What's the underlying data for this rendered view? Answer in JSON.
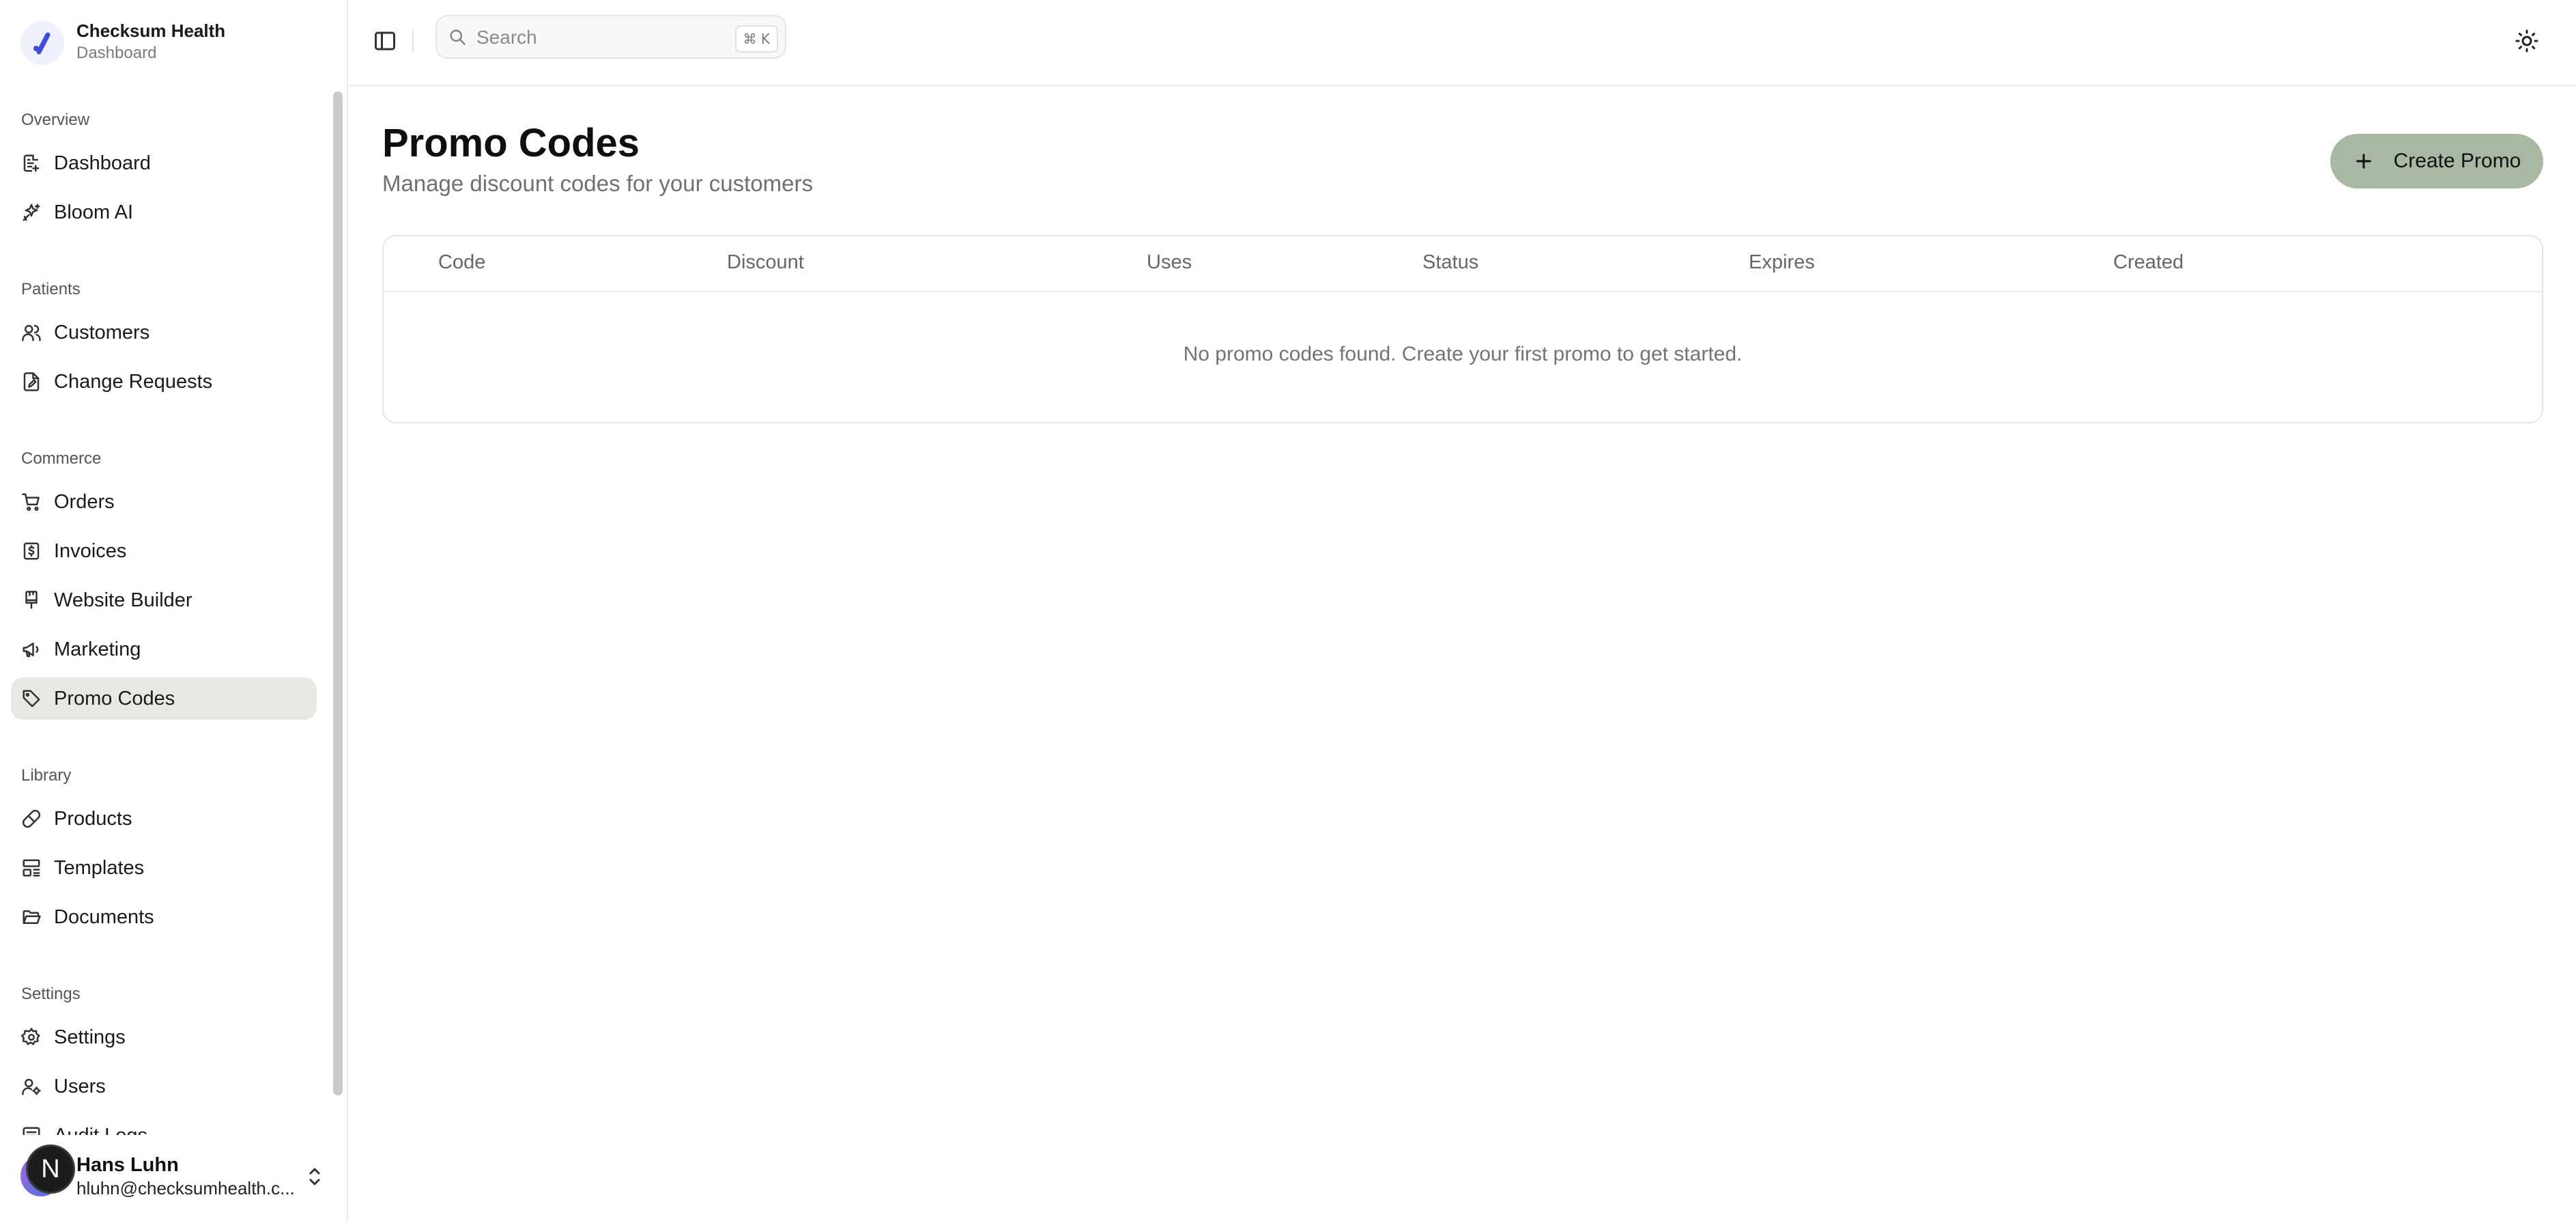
{
  "brand": {
    "name": "Checksum Health",
    "subtitle": "Dashboard"
  },
  "sidebar": {
    "sections": [
      {
        "title": "Overview",
        "items": [
          {
            "label": "Dashboard",
            "icon": "dashboard-icon"
          },
          {
            "label": "Bloom AI",
            "icon": "sparkles-icon"
          }
        ]
      },
      {
        "title": "Patients",
        "items": [
          {
            "label": "Customers",
            "icon": "users-icon"
          },
          {
            "label": "Change Requests",
            "icon": "file-edit-icon"
          }
        ]
      },
      {
        "title": "Commerce",
        "items": [
          {
            "label": "Orders",
            "icon": "cart-icon"
          },
          {
            "label": "Invoices",
            "icon": "invoice-icon"
          },
          {
            "label": "Website Builder",
            "icon": "brush-icon"
          },
          {
            "label": "Marketing",
            "icon": "megaphone-icon"
          },
          {
            "label": "Promo Codes",
            "icon": "tag-icon",
            "active": true
          }
        ]
      },
      {
        "title": "Library",
        "items": [
          {
            "label": "Products",
            "icon": "pill-icon"
          },
          {
            "label": "Templates",
            "icon": "layout-icon"
          },
          {
            "label": "Documents",
            "icon": "folder-icon"
          }
        ]
      },
      {
        "title": "Settings",
        "items": [
          {
            "label": "Settings",
            "icon": "gear-icon"
          },
          {
            "label": "Users",
            "icon": "user-key-icon"
          },
          {
            "label": "Audit Logs",
            "icon": "logs-icon"
          }
        ]
      }
    ]
  },
  "user": {
    "initial": "N",
    "name": "Hans Luhn",
    "email": "hluhn@checksumhealth.c..."
  },
  "topbar": {
    "search_placeholder": "Search",
    "shortcut": "⌘ K"
  },
  "page": {
    "title": "Promo Codes",
    "subtitle": "Manage discount codes for your customers",
    "create_label": "Create Promo"
  },
  "table": {
    "columns": [
      "Code",
      "Discount",
      "Uses",
      "Status",
      "Expires",
      "Created"
    ],
    "empty_message": "No promo codes found. Create your first promo to get started."
  },
  "colors": {
    "active_bg": "#e6e9e2",
    "primary_button": "#a9b8a2",
    "logo_accent": "#3b4ce0"
  }
}
